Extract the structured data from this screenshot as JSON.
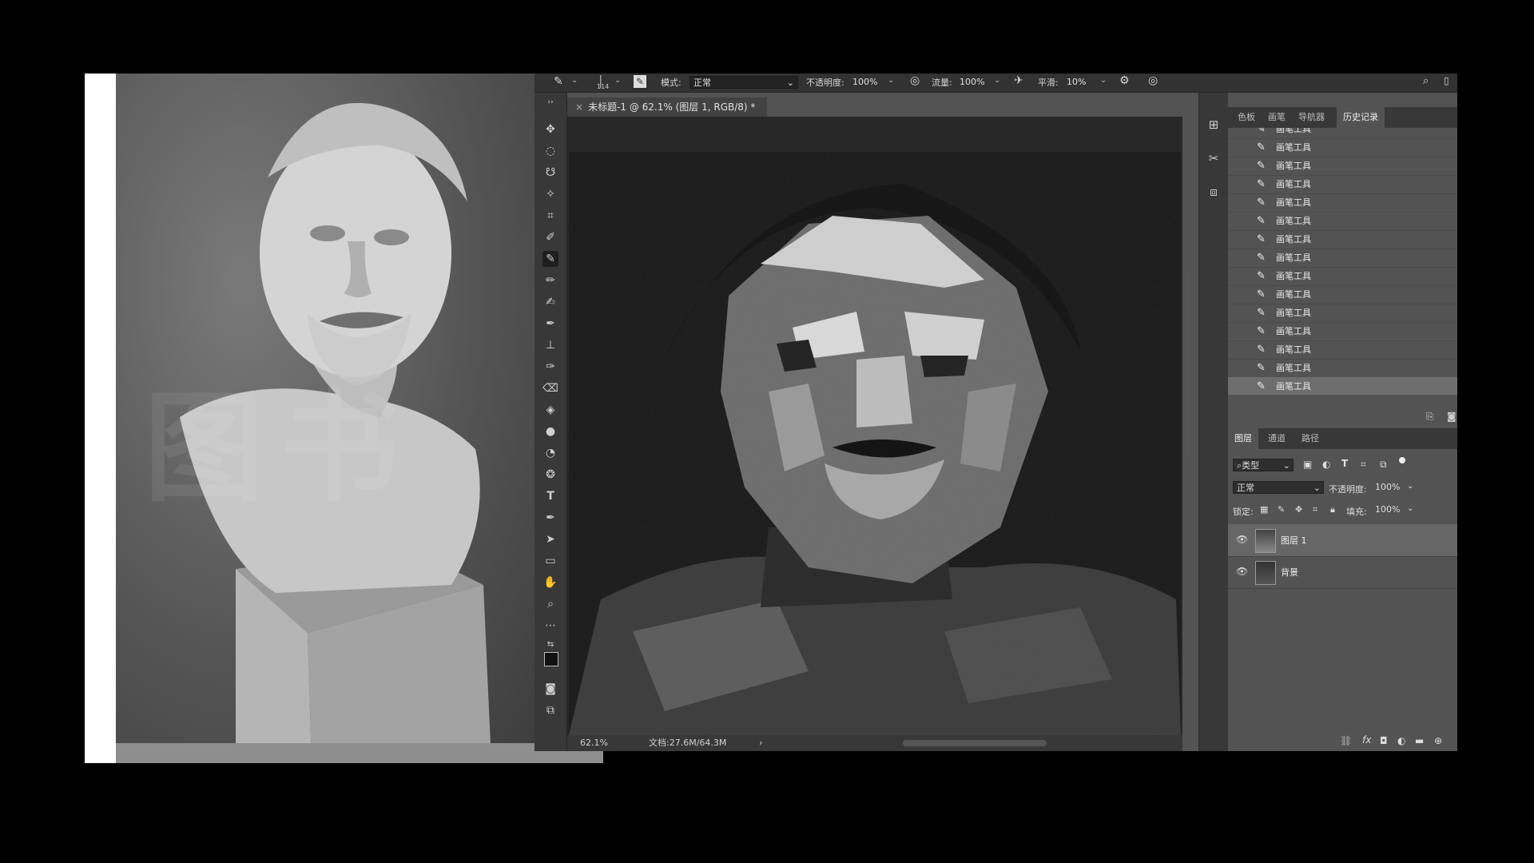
{
  "reference": {
    "watermark": "图书"
  },
  "options_bar": {
    "brush_size": "114",
    "mode_label": "模式:",
    "mode_value": "正常",
    "opacity_label": "不透明度:",
    "opacity_value": "100%",
    "flow_label": "流量:",
    "flow_value": "100%",
    "smooth_label": "平滑:",
    "smooth_value": "10%"
  },
  "document": {
    "tab_title": "未标题-1 @ 62.1% (图层 1, RGB/8) *",
    "zoom": "62.1%",
    "doc_size": "文档:27.6M/64.3M"
  },
  "history_panel": {
    "tabs": [
      "色板",
      "画笔",
      "导航器",
      "历史记录"
    ],
    "active_tab": "历史记录",
    "items": [
      "画笔工具",
      "画笔工具",
      "画笔工具",
      "画笔工具",
      "画笔工具",
      "画笔工具",
      "画笔工具",
      "画笔工具",
      "画笔工具",
      "画笔工具",
      "画笔工具",
      "画笔工具",
      "画笔工具",
      "画笔工具",
      "画笔工具"
    ]
  },
  "layers_panel": {
    "tabs": [
      "图层",
      "通道",
      "路径"
    ],
    "active_tab": "图层",
    "filter_label": "类型",
    "blend_mode": "正常",
    "opacity_label": "不透明度:",
    "opacity_value": "100%",
    "lock_label": "锁定:",
    "fill_label": "填充:",
    "fill_value": "100%",
    "layers": [
      {
        "name": "图层 1",
        "selected": true
      },
      {
        "name": "背景",
        "selected": false
      }
    ],
    "footer_fx": "fx"
  },
  "colors": {
    "ui_dark": "#323232",
    "panel": "#535353",
    "selected_row": "#6e6e6e"
  }
}
